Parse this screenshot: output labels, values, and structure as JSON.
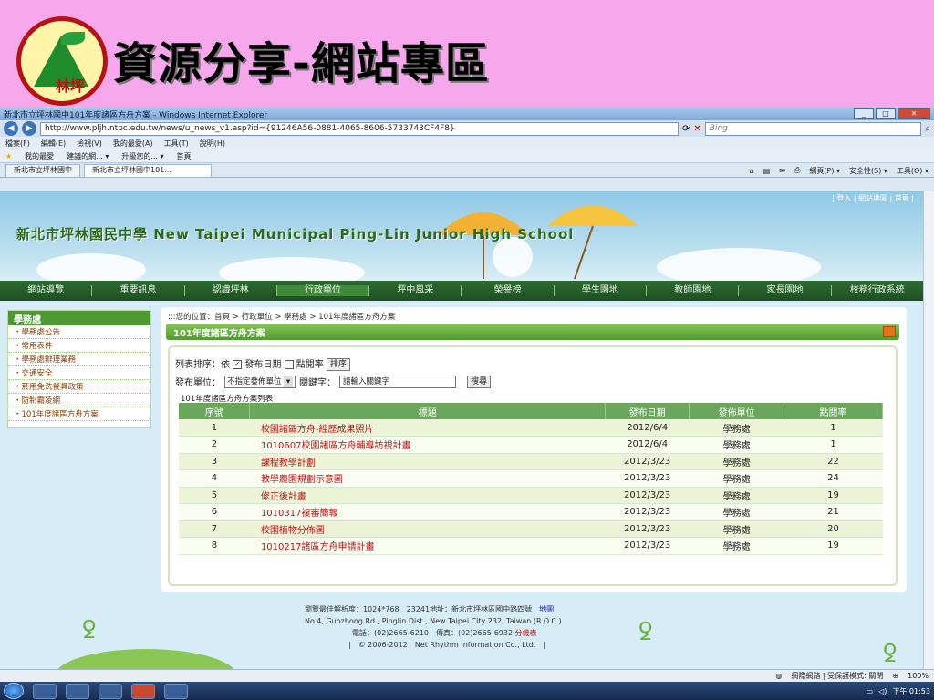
{
  "slide": {
    "title": "資源分享-網站專區",
    "logo_text": "林坪"
  },
  "browser": {
    "window_title": "新北市立坪林國中101年度諸區方舟方案 - Windows Internet Explorer",
    "url": "http://www.pljh.ntpc.edu.tw/news/u_news_v1.asp?id={91246A56-0881-4065-8606-5733743CF4F8}",
    "search_placeholder": "Bing",
    "menu": [
      "檔案(F)",
      "編輯(E)",
      "檢視(V)",
      "我的最愛(A)",
      "工具(T)",
      "說明(H)"
    ],
    "favorites": [
      "我的最愛",
      "建議的網... ▾",
      "升級您的... ▾",
      "首頁"
    ],
    "tabs": [
      "新北市立坪林國中",
      "新北市立坪林國中101..."
    ],
    "tab_tools": [
      "網頁(P) ▾",
      "安全性(S) ▾",
      "工具(O) ▾"
    ]
  },
  "site": {
    "top_links": "| 登入 | 網站地圖 | 首頁 |",
    "school_name": "新北市坪林國民中學 New Taipei Municipal Ping-Lin Junior High School",
    "nav": [
      "網站導覽",
      "重要訊息",
      "認識坪林",
      "行政單位",
      "坪中風采",
      "榮譽榜",
      "學生園地",
      "教師園地",
      "家長園地",
      "校務行政系統"
    ]
  },
  "sidebar": {
    "heading": "學務處",
    "items": [
      "學務處公告",
      "常用表件",
      "學務處辦理業務",
      "交通安全",
      "菸用免洗餐具政策",
      "防制霸凌網",
      "101年度諸區方舟方案"
    ]
  },
  "main": {
    "breadcrumb": ":::您的位置：首頁 > 行政單位 > 學務處 > 101年度諸區方舟方案",
    "section_title": "101年度諸區方舟方案",
    "sort_label": "列表排序：依",
    "sort_date": "發布日期",
    "sort_clicks": "點閱率",
    "sort_button": "排序",
    "unit_label": "發布單位：",
    "unit_select": "不指定發佈單位",
    "keyword_label": "關鍵字：",
    "keyword_placeholder": "請輸入關鍵字",
    "search_button": "搜尋",
    "list_caption": "101年度諸區方舟方案列表",
    "columns": [
      "序號",
      "標題",
      "發布日期",
      "發佈單位",
      "點閱率"
    ],
    "rows": [
      {
        "no": "1",
        "title": "校園諸區方舟-經歷成果照片",
        "date": "2012/6/4",
        "unit": "學務處",
        "clicks": "1"
      },
      {
        "no": "2",
        "title": "1010607校園諸區方舟輔導訪視計畫",
        "date": "2012/6/4",
        "unit": "學務處",
        "clicks": "1"
      },
      {
        "no": "3",
        "title": "課程教學計劃",
        "date": "2012/3/23",
        "unit": "學務處",
        "clicks": "22"
      },
      {
        "no": "4",
        "title": "教學農園規劃示意圖",
        "date": "2012/3/23",
        "unit": "學務處",
        "clicks": "24"
      },
      {
        "no": "5",
        "title": "修正後計畫",
        "date": "2012/3/23",
        "unit": "學務處",
        "clicks": "19"
      },
      {
        "no": "6",
        "title": "1010317複審簡報",
        "date": "2012/3/23",
        "unit": "學務處",
        "clicks": "21"
      },
      {
        "no": "7",
        "title": "校園植物分佈圖",
        "date": "2012/3/23",
        "unit": "學務處",
        "clicks": "20"
      },
      {
        "no": "8",
        "title": "1010217諸區方舟申請計畫",
        "date": "2012/3/23",
        "unit": "學務處",
        "clicks": "19"
      }
    ]
  },
  "footer": {
    "line1": "瀏覽最佳解析度：1024*768　23241地址：新北市坪林區國中路四號",
    "map_link": "地圖",
    "line2": "No.4, Guozhong Rd., Pinglin Dist., New Taipei City 232, Taiwan (R.O.C.)",
    "line3": "電話：(02)2665-6210　傳真：(02)2665-6932",
    "line3_link": "分機表",
    "line4": "|　© 2006-2012　Net Rhythm Information Co., Ltd.　|"
  },
  "statusbar": {
    "zone": "網際網路 | 受保護模式: 關閉",
    "zoom": "100%"
  },
  "taskbar": {
    "clock": "下午 01:53"
  }
}
